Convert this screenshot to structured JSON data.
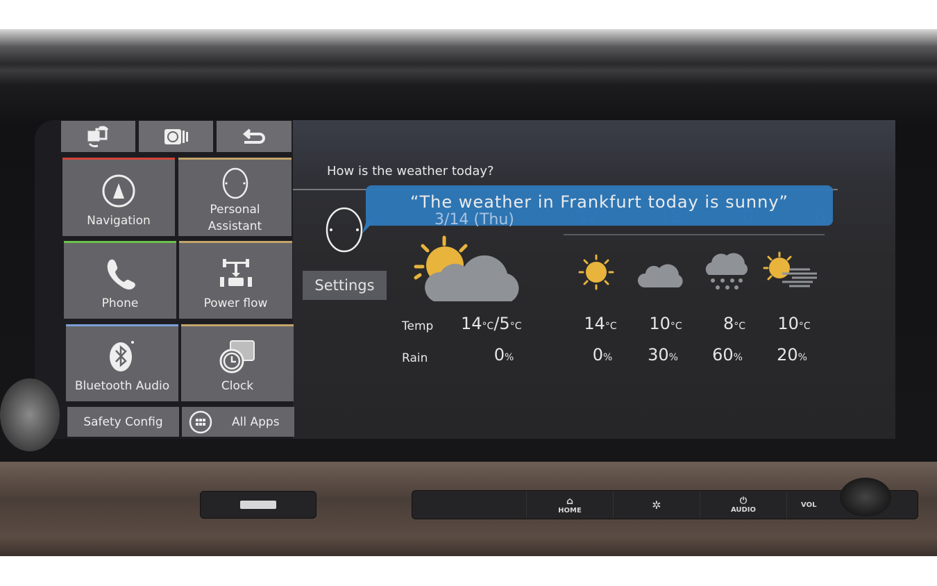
{
  "toolbar": {
    "icons": [
      "screen-switch-icon",
      "history-icon",
      "back-icon"
    ]
  },
  "tiles": [
    {
      "label": "Navigation",
      "accent": "#d0453a",
      "icon": "navigation-icon"
    },
    {
      "label": "Personal Assistant",
      "accent": "#c4a46a",
      "icon": "assistant-icon"
    },
    {
      "label": "Phone",
      "accent": "#6cc24a",
      "icon": "phone-icon"
    },
    {
      "label": "Power flow",
      "accent": "#c4a46a",
      "icon": "power-flow-icon"
    },
    {
      "label": "Bluetooth Audio",
      "accent": "#7a9fd6",
      "icon": "bluetooth-icon"
    },
    {
      "label": "Clock",
      "accent": "#c4a46a",
      "icon": "clock-icon"
    }
  ],
  "bottom": {
    "safety": "Safety Config",
    "all_apps": "All Apps"
  },
  "assistant": {
    "question": "How is the weather today?",
    "response": "“The weather in Frankfurt today is sunny”",
    "settings": "Settings",
    "bubble_color": "#2f78b8"
  },
  "weather": {
    "date": "3/14 (Thu)",
    "hours": [
      "12",
      "18",
      "0",
      "6"
    ],
    "temp_label": "Temp",
    "rain_label": "Rain",
    "today": {
      "icon": "partly-sunny-icon",
      "temp_high": "14",
      "temp_low": "5",
      "unit": "°C",
      "rain": "0",
      "rain_unit": "%"
    },
    "forecast": [
      {
        "icon": "sunny-icon",
        "temp": "14",
        "rain": "0"
      },
      {
        "icon": "cloudy-icon",
        "temp": "10",
        "rain": "30"
      },
      {
        "icon": "snow-icon",
        "temp": "8",
        "rain": "60"
      },
      {
        "icon": "sun-fog-icon",
        "temp": "10",
        "rain": "20"
      }
    ]
  },
  "hardware": {
    "home": "HOME",
    "audio": "AUDIO",
    "vol": "VOL"
  }
}
